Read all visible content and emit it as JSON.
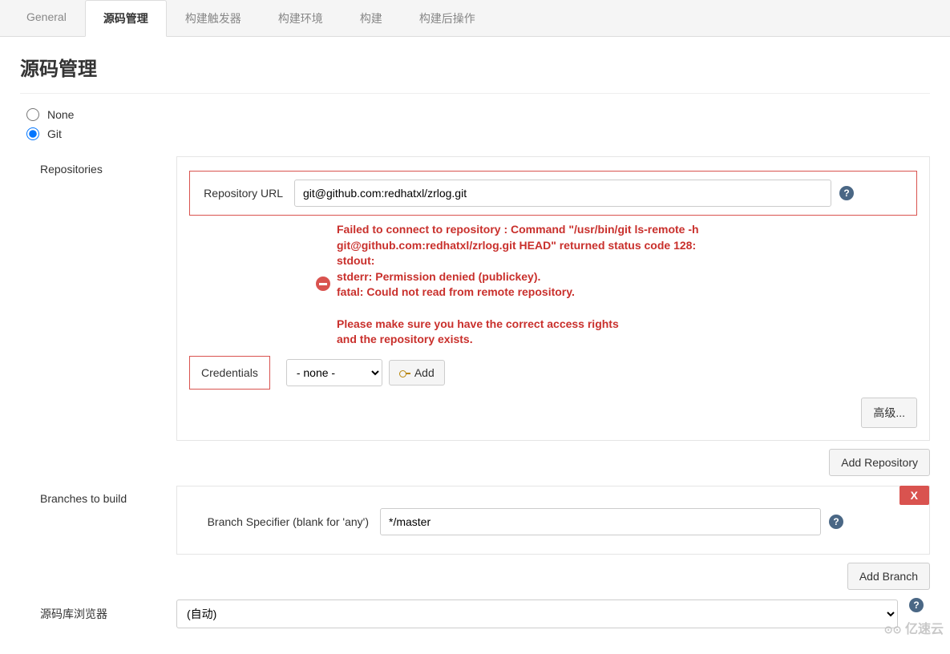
{
  "tabs": [
    {
      "label": "General"
    },
    {
      "label": "源码管理"
    },
    {
      "label": "构建触发器"
    },
    {
      "label": "构建环境"
    },
    {
      "label": "构建"
    },
    {
      "label": "构建后操作"
    }
  ],
  "activeTab": 1,
  "section": {
    "title": "源码管理"
  },
  "scm": {
    "none_label": "None",
    "git_label": "Git",
    "selected": "git"
  },
  "repositories": {
    "label": "Repositories",
    "url_label": "Repository URL",
    "url_value": "git@github.com:redhatxl/zrlog.git",
    "credentials_label": "Credentials",
    "credentials_value": "- none -",
    "add_button": "Add",
    "advanced_button": "高级...",
    "add_repo_button": "Add Repository",
    "error": "Failed to connect to repository : Command \"/usr/bin/git ls-remote -h git@github.com:redhatxl/zrlog.git HEAD\" returned status code 128:\nstdout:\nstderr: Permission denied (publickey).\nfatal: Could not read from remote repository.\n\nPlease make sure you have the correct access rights\nand the repository exists."
  },
  "branches": {
    "label": "Branches to build",
    "specifier_label": "Branch Specifier (blank for 'any')",
    "specifier_value": "*/master",
    "add_branch_button": "Add Branch",
    "delete_x": "X"
  },
  "browser": {
    "label": "源码库浏览器",
    "value": "(自动)"
  },
  "watermark": "亿速云"
}
